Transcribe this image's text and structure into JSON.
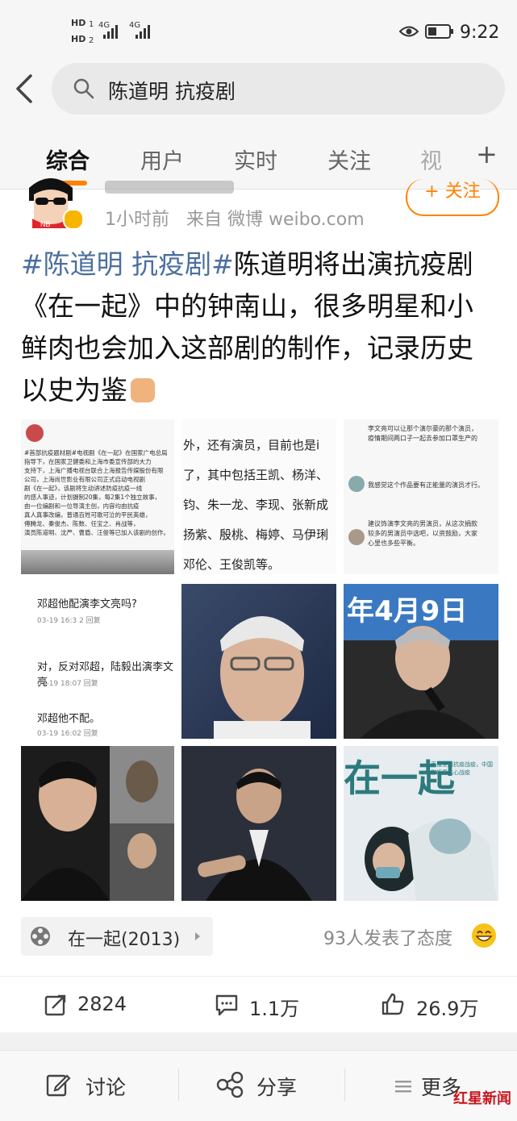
{
  "status_bar": {
    "hd1": "HD",
    "hd2": "HD",
    "sim1_index": "1",
    "sim2_index": "2",
    "network1": "4G",
    "network2": "4G",
    "time": "9:22"
  },
  "search": {
    "query": "陈道明 抗疫剧"
  },
  "tabs": [
    {
      "label": "综合",
      "active": true
    },
    {
      "label": "用户",
      "active": false
    },
    {
      "label": "实时",
      "active": false
    },
    {
      "label": "关注",
      "active": false
    },
    {
      "label": "视",
      "active": false
    }
  ],
  "tabs_more": "+",
  "post": {
    "follow_label": "+ 关注",
    "time": "1小时前",
    "source": "来自 微博 weibo.com",
    "hashtag": "#陈道明 抗疫剧#",
    "body": "陈道明将出演抗疫剧《在一起》中的钟南山，很多明星和小鲜肉也会加入这部剧的制作，记录历史以史为鉴",
    "images": {
      "img1_lines": [
        "#首部抗疫题材剧#电视剧《在一起》在国家广电总局",
        "指导下，在国家卫健委和上海市委宣传部的大力",
        "支持下，上海广播电视台联合上海报告传媒股份有限",
        "公司，上海尚世影业有限公司正式启动电视剧",
        "剧《在一起》，该剧将生动讲述防疫抗疫一线",
        "的感人事迹，计划摄制20集，每2集1个独立故事，",
        "由一位编剧和一位导演主创，内容均由抗疫",
        "真人真事改编，普通百姓可歌可泣的平民英雄，",
        "傅腾龙、秦俊杰、陈数、任宝之、肖战等，",
        "演员陈道明、沈严、曹盾、汪俊等已加入该剧的创作。"
      ],
      "img2_lines": [
        "外，还有演员，目前也是i",
        "了，其中包括王凯、杨洋、",
        "钧、朱一龙、李现、张新成",
        "扬紫、殷桃、梅婷、马伊琍",
        "邓伦、王俊凯等。"
      ],
      "img3_lines": [
        "李文亮可以让那个演尔豪的那个演员，",
        "疫情期间两口子一起去参加口罩生产的",
        "我感觉这个作品要有正能量的演员才行。",
        "建议饰演李文亮的男演员，从这次捐款",
        "较多的男演员中选吧，以资鼓励，大家",
        "心里也多些平衡。"
      ],
      "img4_lines": [
        "邓超他配演李文亮吗?",
        "03-19 16:3  2 回复",
        "对，反对邓超，陆毅出演李文亮",
        "03-19 18:07  回复",
        "邓超他不配。",
        "03-19 16:02  回复"
      ],
      "img6_caption": "年4月9日",
      "img9_caption": "在一起",
      "img9_sub": "直播全面抗疫战疫，中国影视界共心战疫"
    },
    "movie": {
      "title": "在一起(2013)"
    },
    "reaction_text": "93人发表了态度",
    "actions": {
      "reposts": "2824",
      "comments": "1.1万",
      "likes": "26.9万"
    }
  },
  "bottom_bar": {
    "comment": "讨论",
    "share": "分享",
    "more": "更多"
  },
  "watermark": "红星新闻",
  "colors": {
    "accent": "#ff8200",
    "hashtag": "#4c6fa0",
    "watermark": "#c8161d"
  },
  "icons": [
    "back-arrow-icon",
    "search-icon",
    "eye-icon",
    "battery-icon",
    "repost-icon",
    "comment-icon",
    "like-icon",
    "edit-icon",
    "share-icon",
    "menu-icon",
    "film-reel-icon",
    "emoji-icon"
  ]
}
